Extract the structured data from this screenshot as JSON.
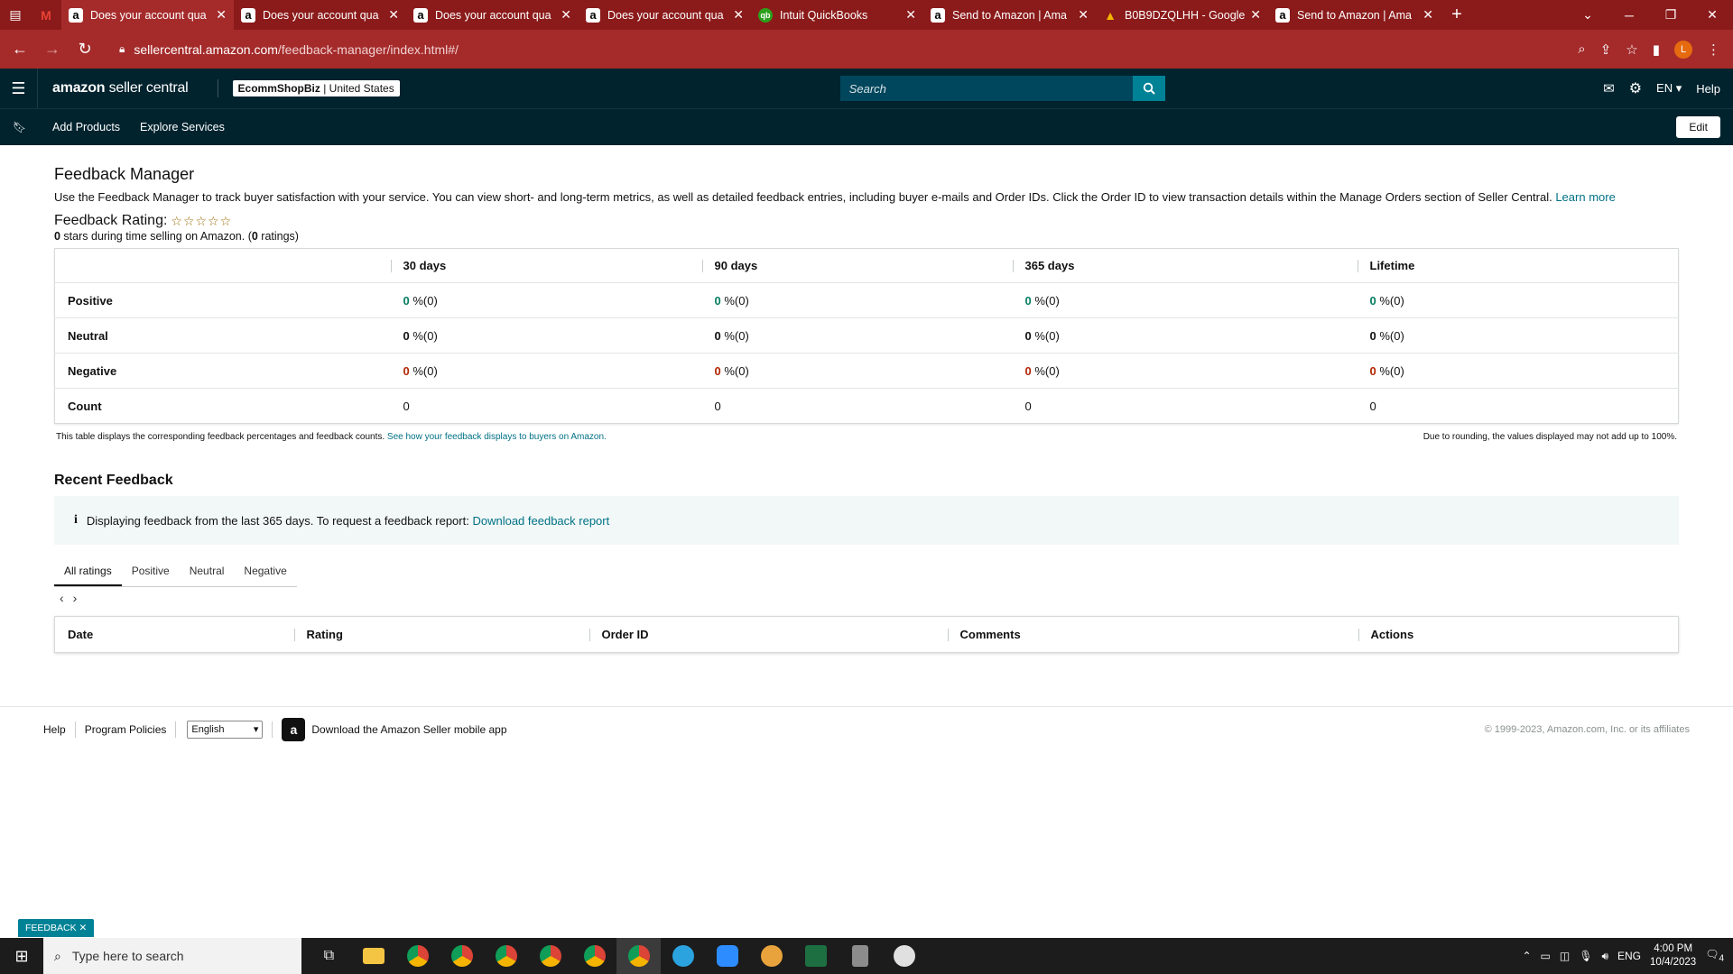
{
  "browser": {
    "tabs": [
      {
        "title": "Does your account qua",
        "favicon": "amazon-a",
        "active": true
      },
      {
        "title": "Does your account qua",
        "favicon": "amazon-a"
      },
      {
        "title": "Does your account qua",
        "favicon": "amazon-a"
      },
      {
        "title": "Does your account qua",
        "favicon": "amazon-a"
      },
      {
        "title": "Intuit QuickBooks",
        "favicon": "qb"
      },
      {
        "title": "Send to Amazon | Ama",
        "favicon": "amazon-a"
      },
      {
        "title": "B0B9DZQLHH - Google",
        "favicon": "google-drive"
      },
      {
        "title": "Send to Amazon | Ama",
        "favicon": "amazon-a"
      }
    ],
    "url_host": "sellercentral.amazon.com",
    "url_path": "/feedback-manager/index.html#/",
    "profile_initial": "L"
  },
  "header": {
    "logo_bold": "amazon",
    "logo_rest": " seller central",
    "store_name": "EcommShopBiz",
    "store_region": " | United States",
    "search_placeholder": "Search",
    "lang": "EN",
    "help": "Help"
  },
  "subnav": {
    "items": [
      "Add Products",
      "Explore Services"
    ],
    "edit": "Edit"
  },
  "page": {
    "title": "Feedback Manager",
    "intro": "Use the Feedback Manager to track buyer satisfaction with your service. You can view short- and long-term metrics, as well as detailed feedback entries, including buyer e-mails and Order IDs. Click the Order ID to view transaction details within the Manage Orders section of Seller Central. ",
    "learn_more": "Learn more",
    "rating_label": "Feedback Rating:",
    "stars_text": "☆☆☆☆☆",
    "rating_sub_stars": "0",
    "rating_sub_mid": " stars during time selling on Amazon. (",
    "rating_sub_count": "0",
    "rating_sub_end": " ratings)"
  },
  "metrics": {
    "columns": [
      "30 days",
      "90 days",
      "365 days",
      "Lifetime"
    ],
    "rows": [
      {
        "label": "Positive",
        "cells": [
          {
            "pct": "0",
            "rest": " %(0)"
          },
          {
            "pct": "0",
            "rest": " %(0)"
          },
          {
            "pct": "0",
            "rest": " %(0)"
          },
          {
            "pct": "0",
            "rest": " %(0)"
          }
        ]
      },
      {
        "label": "Neutral",
        "cells": [
          {
            "pct": "0",
            "rest": " %(0)"
          },
          {
            "pct": "0",
            "rest": " %(0)"
          },
          {
            "pct": "0",
            "rest": " %(0)"
          },
          {
            "pct": "0",
            "rest": " %(0)"
          }
        ]
      },
      {
        "label": "Negative",
        "cells": [
          {
            "pct": "0",
            "rest": " %(0)"
          },
          {
            "pct": "0",
            "rest": " %(0)"
          },
          {
            "pct": "0",
            "rest": " %(0)"
          },
          {
            "pct": "0",
            "rest": " %(0)"
          }
        ]
      },
      {
        "label": "Count",
        "cells": [
          "0",
          "0",
          "0",
          "0"
        ]
      }
    ],
    "note_left": "This table displays the corresponding feedback percentages and feedback counts. ",
    "note_left_link": "See how your feedback displays to buyers on Amazon.",
    "note_right": "Due to rounding, the values displayed may not add up to 100%."
  },
  "recent": {
    "title": "Recent Feedback",
    "info_text": "Displaying feedback from the last 365 days. To request a feedback report: ",
    "info_link": "Download feedback report",
    "tabs": [
      "All ratings",
      "Positive",
      "Neutral",
      "Negative"
    ],
    "columns": [
      "Date",
      "Rating",
      "Order ID",
      "Comments",
      "Actions"
    ]
  },
  "footer": {
    "help": "Help",
    "policies": "Program Policies",
    "language": "English",
    "app_text": "Download the Amazon Seller mobile app",
    "copyright": "© 1999-2023, Amazon.com, Inc. or its affiliates"
  },
  "feedback_pill": "FEEDBACK",
  "taskbar": {
    "search_placeholder": "Type here to search",
    "lang": "ENG",
    "time": "4:00 PM",
    "date": "10/4/2023",
    "notif_count": "4"
  },
  "colors": {
    "browser_frame": "#8b1a1a",
    "header_bg": "#00232e",
    "accent": "#008296",
    "positive": "#067d62",
    "negative": "#b12704",
    "link": "#007185"
  }
}
